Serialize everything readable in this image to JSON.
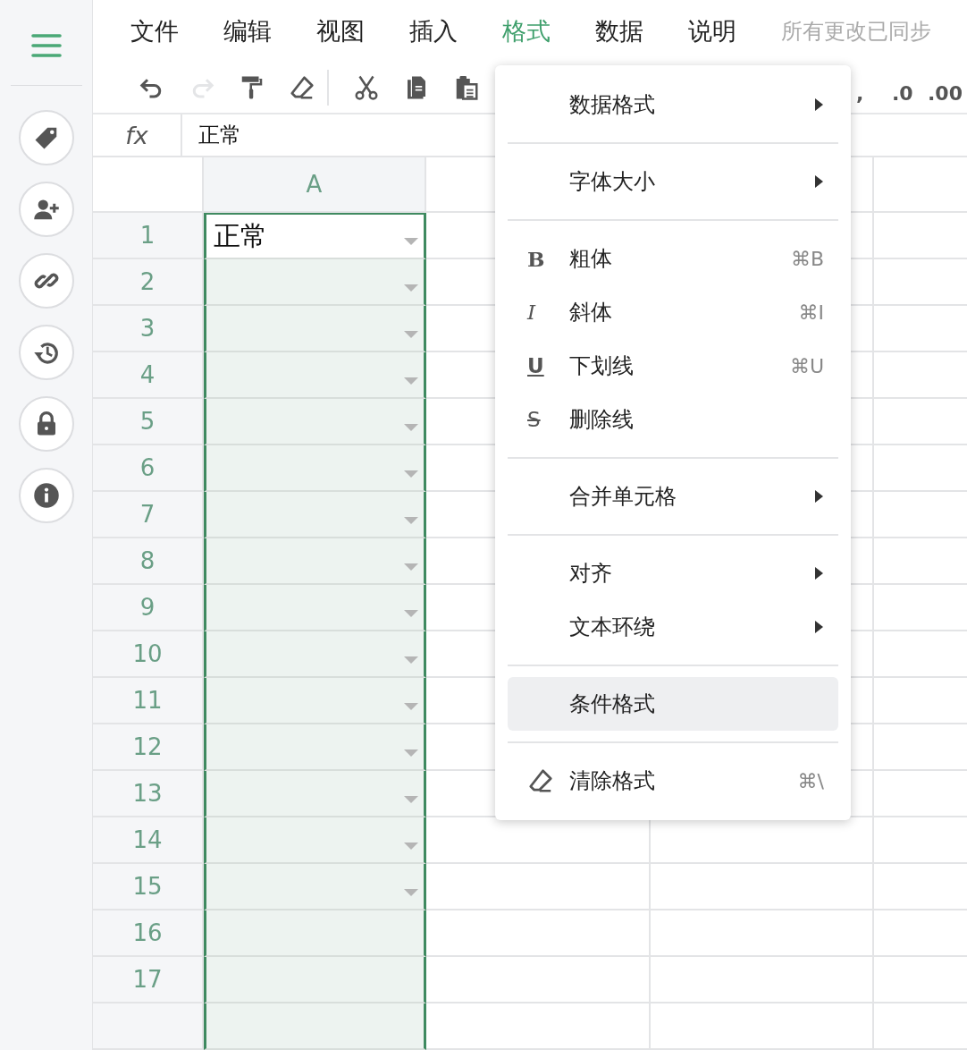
{
  "menu_bar": [
    {
      "label": "文件",
      "selected": false
    },
    {
      "label": "编辑",
      "selected": false
    },
    {
      "label": "视图",
      "selected": false
    },
    {
      "label": "插入",
      "selected": false
    },
    {
      "label": "格式",
      "selected": true
    },
    {
      "label": "数据",
      "selected": false
    },
    {
      "label": "说明",
      "selected": false
    }
  ],
  "sync_status": "所有更改已同步",
  "toolbar": [
    [
      {
        "kind": "undo",
        "disabled": false
      },
      {
        "kind": "redo",
        "disabled": true
      },
      {
        "kind": "paint",
        "disabled": false
      },
      {
        "kind": "eraser",
        "disabled": false
      }
    ],
    [
      {
        "kind": "cut",
        "disabled": false
      },
      {
        "kind": "copy",
        "disabled": false
      },
      {
        "kind": "paste",
        "disabled": false
      }
    ]
  ],
  "toolbar_texts": [
    ",",
    ".0",
    ".00"
  ],
  "formula_bar": {
    "label": "fx",
    "value": "正常"
  },
  "sheet": {
    "columns": [
      {
        "label": "A",
        "selected": true
      },
      {
        "selected": false
      },
      {
        "selected": false
      },
      {
        "selected": false
      }
    ],
    "rows": [
      {
        "number": "1",
        "value": "正常",
        "dropdown": true
      },
      {
        "number": "2",
        "dropdown": true
      },
      {
        "number": "3",
        "dropdown": true
      },
      {
        "number": "4",
        "dropdown": true
      },
      {
        "number": "5",
        "dropdown": true
      },
      {
        "number": "6",
        "dropdown": true
      },
      {
        "number": "7",
        "dropdown": true
      },
      {
        "number": "8",
        "dropdown": true
      },
      {
        "number": "9",
        "dropdown": true
      },
      {
        "number": "10",
        "dropdown": true
      },
      {
        "number": "11",
        "dropdown": true
      },
      {
        "number": "12",
        "dropdown": true
      },
      {
        "number": "13",
        "dropdown": true
      },
      {
        "number": "14",
        "dropdown": true
      },
      {
        "number": "15",
        "dropdown": true
      },
      {
        "number": "16",
        "dropdown": false
      },
      {
        "number": "17",
        "dropdown": false
      }
    ]
  },
  "sidebar": [
    {
      "kind": "tag"
    },
    {
      "kind": "add-user"
    },
    {
      "kind": "link"
    },
    {
      "kind": "history"
    },
    {
      "kind": "lock"
    },
    {
      "kind": "info"
    }
  ],
  "format_menu": [
    [
      {
        "label": "数据格式",
        "submenu": true,
        "highlighted": false
      }
    ],
    [
      {
        "label": "字体大小",
        "submenu": true,
        "highlighted": false
      }
    ],
    [
      {
        "label": "粗体",
        "glyph": "B",
        "kind": "bold",
        "shortcut": "⌘B",
        "submenu": false,
        "highlighted": false
      },
      {
        "label": "斜体",
        "glyph": "I",
        "kind": "italic",
        "shortcut": "⌘I",
        "submenu": false,
        "highlighted": false
      },
      {
        "label": "下划线",
        "glyph": "U",
        "kind": "underline",
        "shortcut": "⌘U",
        "submenu": false,
        "highlighted": false
      },
      {
        "label": "删除线",
        "glyph": "S",
        "kind": "strike",
        "submenu": false,
        "highlighted": false
      }
    ],
    [
      {
        "label": "合并单元格",
        "submenu": true,
        "highlighted": false
      }
    ],
    [
      {
        "label": "对齐",
        "submenu": true,
        "highlighted": false
      },
      {
        "label": "文本环绕",
        "submenu": true,
        "highlighted": false
      }
    ],
    [
      {
        "label": "条件格式",
        "submenu": false,
        "highlighted": true
      }
    ],
    [
      {
        "label": "清除格式",
        "kind": "eraser",
        "shortcut": "⌘\\",
        "submenu": false,
        "highlighted": false
      }
    ]
  ]
}
